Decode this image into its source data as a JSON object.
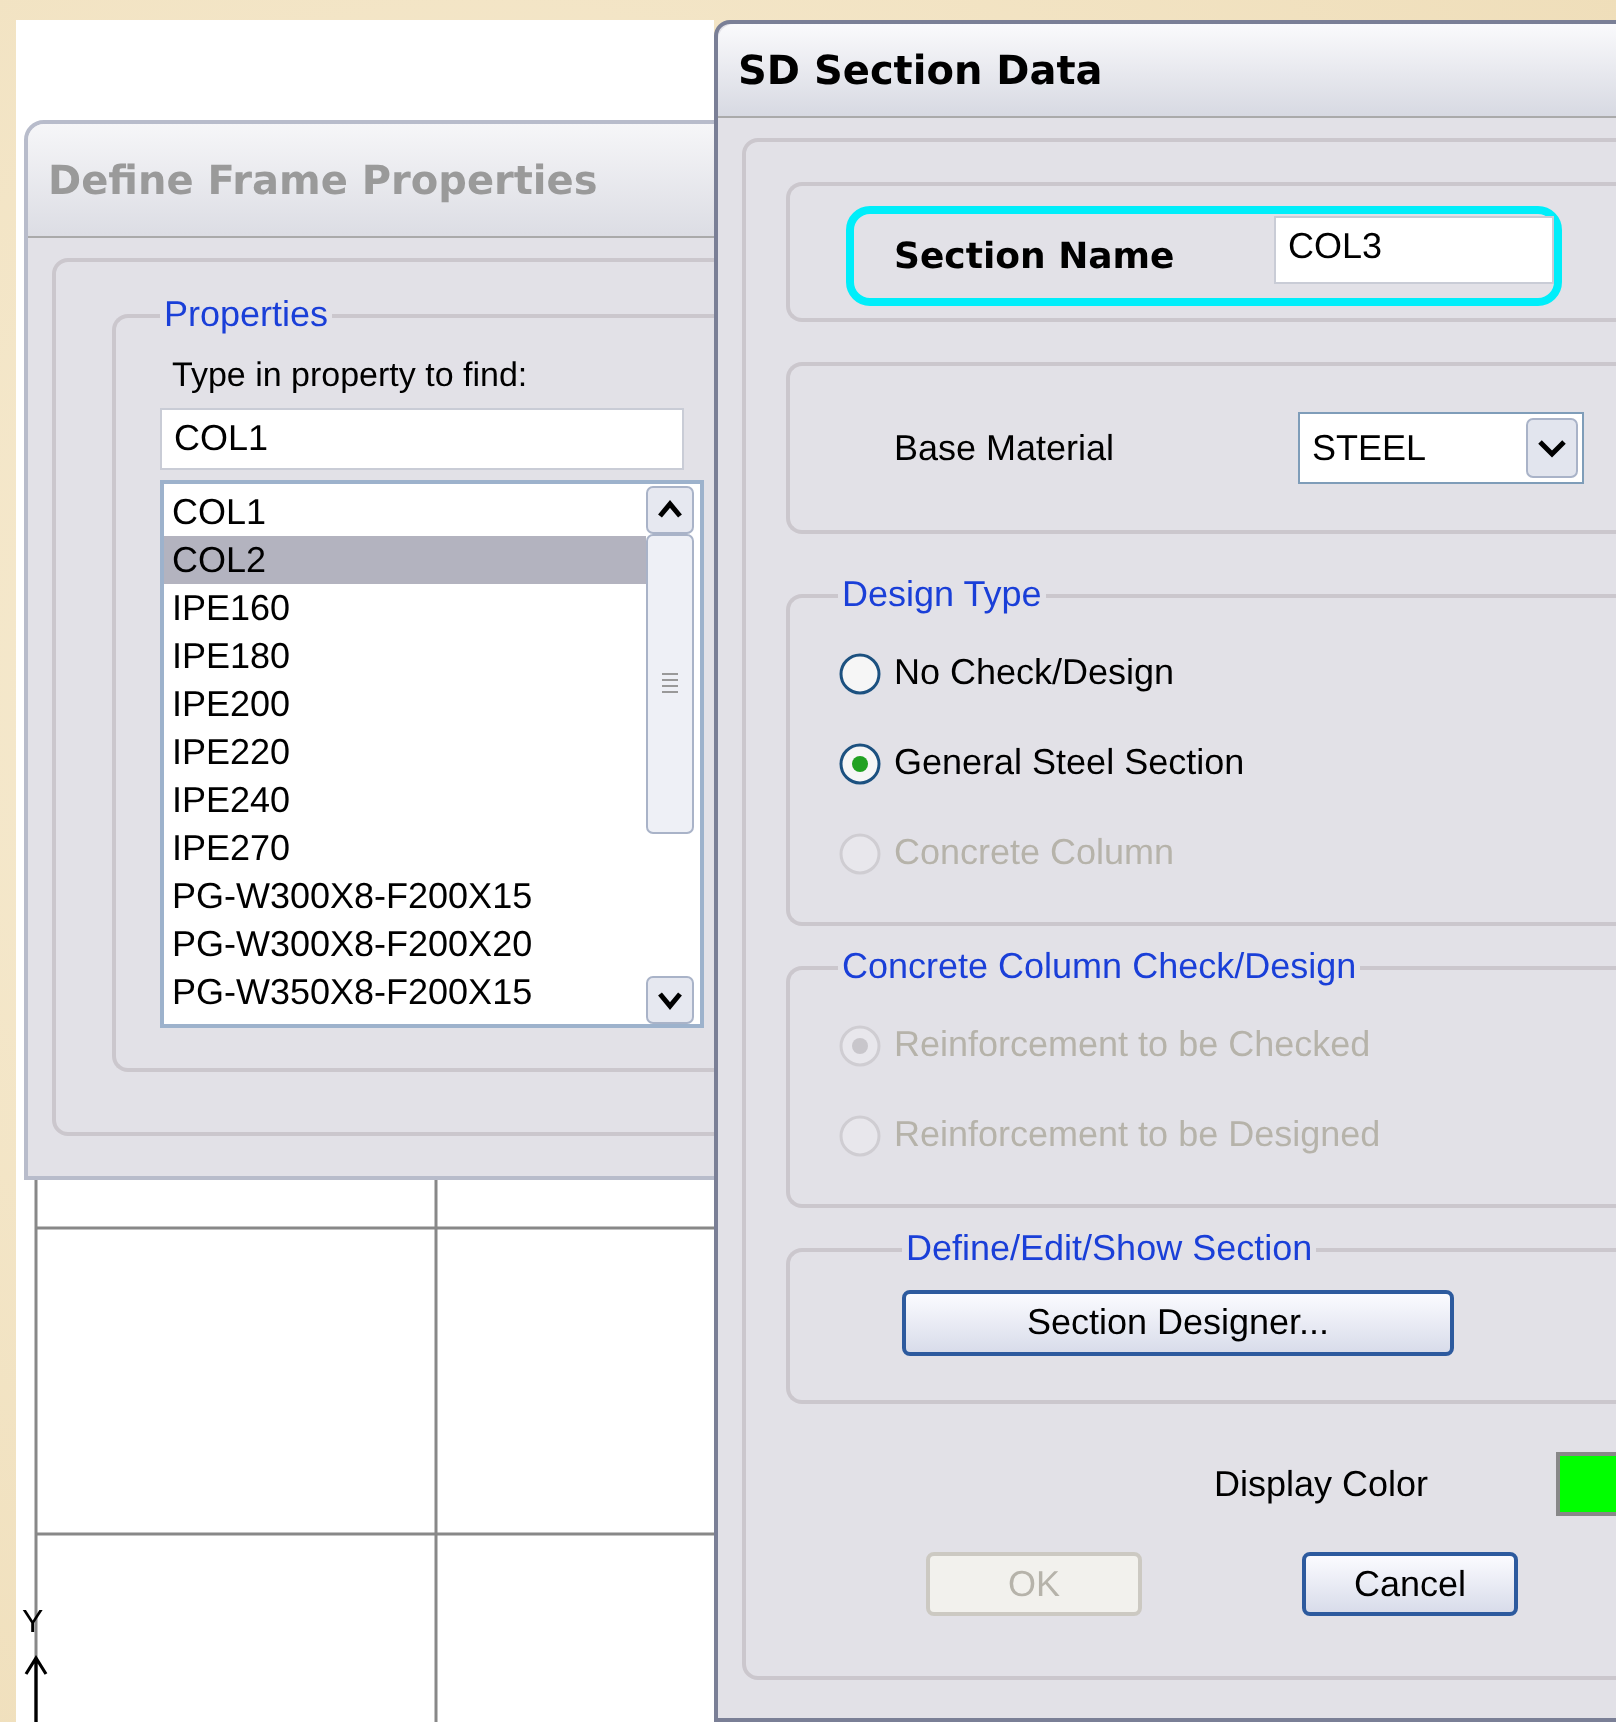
{
  "canvas": {
    "axis_label": "Y"
  },
  "define_frame_properties": {
    "title": "Define Frame Properties",
    "active": false,
    "group_title": "Properties",
    "find_label": "Type in property to find:",
    "find_value": "COL1",
    "items": [
      {
        "label": "COL1",
        "selected": false
      },
      {
        "label": "COL2",
        "selected": true
      },
      {
        "label": "IPE160",
        "selected": false
      },
      {
        "label": "IPE180",
        "selected": false
      },
      {
        "label": "IPE200",
        "selected": false
      },
      {
        "label": "IPE220",
        "selected": false
      },
      {
        "label": "IPE240",
        "selected": false
      },
      {
        "label": "IPE270",
        "selected": false
      },
      {
        "label": "PG-W300X8-F200X15",
        "selected": false
      },
      {
        "label": "PG-W300X8-F200X20",
        "selected": false
      },
      {
        "label": "PG-W350X8-F200X15",
        "selected": false
      }
    ]
  },
  "section_data": {
    "title": "SD Section Data",
    "active": true,
    "section_name_label": "Section Name",
    "section_name_value": "COL3",
    "base_material_label": "Base Material",
    "base_material_value": "STEEL",
    "groups": [
      {
        "title": "Design Type",
        "options": [
          {
            "label": "No Check/Design",
            "selected": false,
            "disabled": false
          },
          {
            "label": "General Steel Section",
            "selected": true,
            "disabled": false
          },
          {
            "label": "Concrete Column",
            "selected": false,
            "disabled": true
          }
        ]
      },
      {
        "title": "Concrete Column Check/Design",
        "options": [
          {
            "label": "Reinforcement to be Checked",
            "selected": true,
            "disabled": true
          },
          {
            "label": "Reinforcement to be Designed",
            "selected": false,
            "disabled": true
          }
        ]
      }
    ],
    "define_section": {
      "title": "Define/Edit/Show Section",
      "button": "Section Designer..."
    },
    "display_color": {
      "label": "Display Color",
      "color": "#00ff00"
    },
    "buttons": [
      {
        "label": "OK",
        "disabled": true
      },
      {
        "label": "Cancel",
        "disabled": false
      }
    ]
  }
}
